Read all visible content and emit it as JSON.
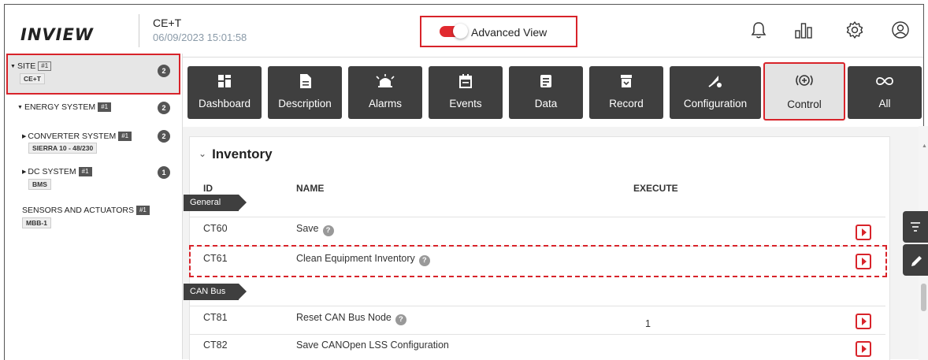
{
  "header": {
    "logo_text": "INVIEW",
    "site_name": "CE+T",
    "datetime": "06/09/2023 15:01:58",
    "advanced_view_label": "Advanced View",
    "advanced_view_on": true,
    "icons": [
      "bell-icon",
      "chart-icon",
      "gear-icon",
      "user-icon"
    ]
  },
  "sidebar": {
    "site": {
      "label": "SITE",
      "tag": "#1",
      "sub": "CE+T",
      "count": "2"
    },
    "energy": {
      "label": "ENERGY SYSTEM",
      "tag": "#1",
      "count": "2"
    },
    "converter": {
      "label": "CONVERTER SYSTEM",
      "tag": "#1",
      "sub": "SIERRA 10 - 48/230",
      "count": "2"
    },
    "dc": {
      "label": "DC SYSTEM",
      "tag": "#1",
      "sub": "BMS",
      "count": "1"
    },
    "sensors": {
      "label": "SENSORS AND ACTUATORS",
      "tag": "#1",
      "sub": "MBB-1"
    }
  },
  "toolbar": {
    "buttons": [
      {
        "label": "Dashboard",
        "icon": "dashboard-icon"
      },
      {
        "label": "Description",
        "icon": "document-icon"
      },
      {
        "label": "Alarms",
        "icon": "alarm-icon"
      },
      {
        "label": "Events",
        "icon": "calendar-icon"
      },
      {
        "label": "Data",
        "icon": "data-icon"
      },
      {
        "label": "Record",
        "icon": "archive-icon"
      },
      {
        "label": "Configuration",
        "icon": "configuration-icon"
      },
      {
        "label": "Control",
        "icon": "control-icon",
        "active": true
      },
      {
        "label": "All",
        "icon": "infinity-icon"
      }
    ]
  },
  "inventory": {
    "title": "Inventory",
    "columns": {
      "id": "ID",
      "name": "NAME",
      "execute": "EXECUTE"
    },
    "groups": [
      {
        "name": "General",
        "rows": [
          {
            "id": "CT60",
            "name": "Save",
            "help": true,
            "value": ""
          },
          {
            "id": "CT61",
            "name": "Clean Equipment Inventory",
            "help": true,
            "value": "",
            "highlighted": true
          }
        ]
      },
      {
        "name": "CAN Bus",
        "rows": [
          {
            "id": "CT81",
            "name": "Reset CAN Bus Node",
            "help": true,
            "value": "1"
          },
          {
            "id": "CT82",
            "name": "Save CANOpen LSS Configuration",
            "help": false,
            "value": ""
          }
        ]
      }
    ],
    "help_glyph": "?"
  },
  "side_buttons": [
    "filter-icon",
    "edit-icon"
  ],
  "colors": {
    "accent_red": "#d8232a",
    "button_dark": "#3f3f3f"
  }
}
